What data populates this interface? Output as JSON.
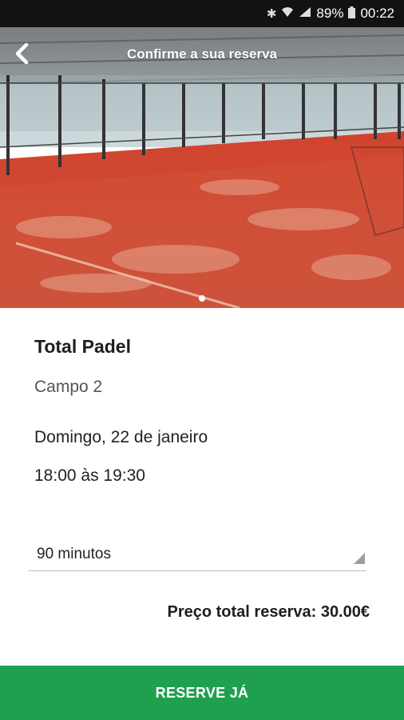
{
  "status_bar": {
    "battery": "89%",
    "time": "00:22"
  },
  "toolbar": {
    "title": "Confirme a sua reserva"
  },
  "booking": {
    "club": "Total Padel",
    "court": "Campo 2",
    "date": "Domingo, 22 de janeiro",
    "time": "18:00 às 19:30"
  },
  "duration": {
    "selected": "90 minutos"
  },
  "price": {
    "label": "Preço total reserva: 30.00€"
  },
  "cta": {
    "label": "RESERVE JÁ"
  },
  "colors": {
    "accent": "#1ea04f",
    "status_bar": "#121212"
  }
}
